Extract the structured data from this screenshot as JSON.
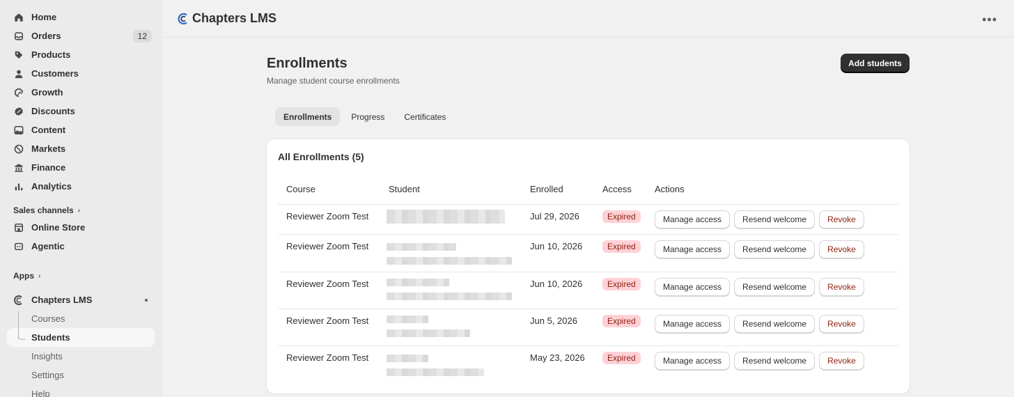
{
  "sidebar": {
    "nav": [
      {
        "label": "Home",
        "icon": "home-icon"
      },
      {
        "label": "Orders",
        "icon": "inbox-icon",
        "badge": "12"
      },
      {
        "label": "Products",
        "icon": "tag-icon"
      },
      {
        "label": "Customers",
        "icon": "person-icon"
      },
      {
        "label": "Growth",
        "icon": "growth-icon"
      },
      {
        "label": "Discounts",
        "icon": "discount-icon"
      },
      {
        "label": "Content",
        "icon": "image-icon"
      },
      {
        "label": "Markets",
        "icon": "globe-icon"
      },
      {
        "label": "Finance",
        "icon": "bank-icon"
      },
      {
        "label": "Analytics",
        "icon": "bar-chart-icon"
      }
    ],
    "sales_channels": {
      "heading": "Sales channels",
      "items": [
        {
          "label": "Online Store",
          "icon": "store-icon"
        },
        {
          "label": "Agentic",
          "icon": "agent-icon"
        }
      ]
    },
    "apps": {
      "heading": "Apps",
      "app_name": "Chapters LMS",
      "sub_items": [
        "Courses",
        "Students",
        "Insights",
        "Settings",
        "Help"
      ]
    }
  },
  "topbar": {
    "title": "Chapters LMS"
  },
  "page": {
    "title": "Enrollments",
    "subtitle": "Manage student course enrollments",
    "primary_action": "Add students"
  },
  "tabs": [
    "Enrollments",
    "Progress",
    "Certificates"
  ],
  "table": {
    "title": "All Enrollments (5)",
    "columns": [
      "Course",
      "Student",
      "Enrolled",
      "Access",
      "Actions"
    ],
    "actions": {
      "manage": "Manage access",
      "resend": "Resend welcome",
      "revoke": "Revoke"
    },
    "rows": [
      {
        "course": "Reviewer Zoom Test",
        "enrolled": "Jul 29, 2026",
        "access": "Expired"
      },
      {
        "course": "Reviewer Zoom Test",
        "enrolled": "Jun 10, 2026",
        "access": "Expired"
      },
      {
        "course": "Reviewer Zoom Test",
        "enrolled": "Jun 10, 2026",
        "access": "Expired"
      },
      {
        "course": "Reviewer Zoom Test",
        "enrolled": "Jun 5, 2026",
        "access": "Expired"
      },
      {
        "course": "Reviewer Zoom Test",
        "enrolled": "May 23, 2026",
        "access": "Expired"
      }
    ]
  },
  "colors": {
    "accent": "#303030",
    "expired_bg": "#fed1d7",
    "expired_text": "#8e1f0b"
  }
}
